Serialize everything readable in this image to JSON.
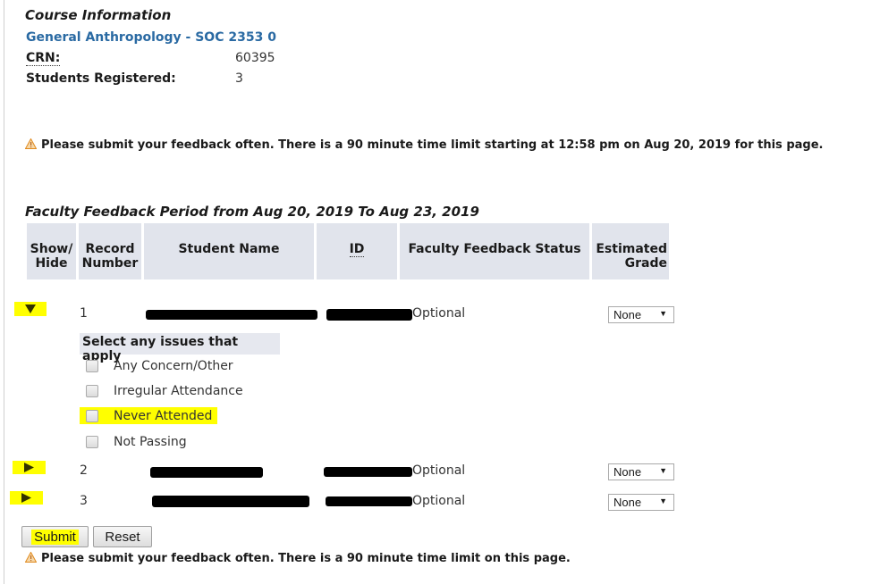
{
  "course": {
    "heading": "Course Information",
    "title": "General Anthropology - SOC 2353 0",
    "crn_label": "CRN:",
    "crn_value": "60395",
    "registered_label": "Students Registered:",
    "registered_value": "3"
  },
  "warning_top": "Please submit your feedback often. There is a 90 minute time limit starting at 12:58 pm on Aug 20, 2019 for this page.",
  "period_heading": "Faculty Feedback Period from Aug 20, 2019 To Aug 23, 2019",
  "table": {
    "headers": {
      "show_hide_1": "Show/",
      "show_hide_2": "Hide",
      "record_1": "Record",
      "record_2": "Number",
      "student_name": "Student Name",
      "id": "ID",
      "status": "Faculty Feedback Status",
      "grade_1": "Estimated",
      "grade_2": "Grade"
    },
    "rows": [
      {
        "record": "1",
        "status": "Optional",
        "grade": "None",
        "expanded": true
      },
      {
        "record": "2",
        "status": "Optional",
        "grade": "None",
        "expanded": false
      },
      {
        "record": "3",
        "status": "Optional",
        "grade": "None",
        "expanded": false
      }
    ],
    "issues": {
      "heading": "Select any issues that apply",
      "options": [
        "Any Concern/Other",
        "Irregular Attendance",
        "Never Attended",
        "Not Passing"
      ]
    }
  },
  "buttons": {
    "submit": "Submit",
    "reset": "Reset"
  },
  "warning_bottom": "Please submit your feedback often. There is a 90 minute time limit on this page.",
  "colors": {
    "link": "#2a6aa3",
    "highlight": "#ffff00",
    "header_bg": "#e1e4ec",
    "warning_icon": "#f0a030"
  }
}
